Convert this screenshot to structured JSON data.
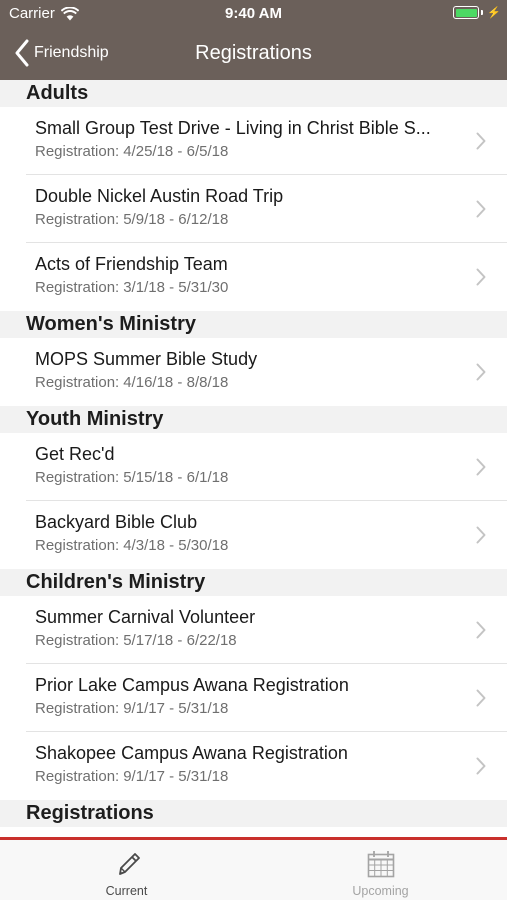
{
  "colors": {
    "nav_background": "#6b605a",
    "tab_accent": "#c9302c",
    "battery_green": "#4cd964"
  },
  "status_bar": {
    "carrier": "Carrier",
    "time": "9:40 AM",
    "battery_level": 1.0
  },
  "nav": {
    "back_label": "Friendship",
    "title": "Registrations"
  },
  "sections": [
    {
      "title": "Adults",
      "items": [
        {
          "title": "Small Group Test Drive - Living in Christ Bible S...",
          "subtitle_label": "Registration:",
          "dates": "4/25/18 - 6/5/18"
        },
        {
          "title": "Double Nickel Austin Road Trip",
          "subtitle_label": "Registration:",
          "dates": "5/9/18 - 6/12/18"
        },
        {
          "title": "Acts of Friendship Team",
          "subtitle_label": "Registration:",
          "dates": "3/1/18 - 5/31/30"
        }
      ]
    },
    {
      "title": "Women's Ministry",
      "items": [
        {
          "title": "MOPS Summer Bible Study",
          "subtitle_label": "Registration:",
          "dates": "4/16/18 - 8/8/18"
        }
      ]
    },
    {
      "title": "Youth Ministry",
      "items": [
        {
          "title": "Get Rec'd",
          "subtitle_label": "Registration:",
          "dates": "5/15/18 - 6/1/18"
        },
        {
          "title": "Backyard Bible Club",
          "subtitle_label": "Registration:",
          "dates": "4/3/18 - 5/30/18"
        }
      ]
    },
    {
      "title": "Children's Ministry",
      "items": [
        {
          "title": "Summer Carnival Volunteer",
          "subtitle_label": "Registration:",
          "dates": "5/17/18 - 6/22/18"
        },
        {
          "title": "Prior Lake Campus Awana Registration",
          "subtitle_label": "Registration:",
          "dates": "9/1/17 - 5/31/18"
        },
        {
          "title": "Shakopee Campus Awana Registration",
          "subtitle_label": "Registration:",
          "dates": "9/1/17 - 5/31/18"
        }
      ]
    },
    {
      "title": "Registrations",
      "items": []
    }
  ],
  "tabs": [
    {
      "label": "Current",
      "icon": "pencil-icon",
      "selected": true
    },
    {
      "label": "Upcoming",
      "icon": "calendar-icon",
      "selected": false
    }
  ]
}
